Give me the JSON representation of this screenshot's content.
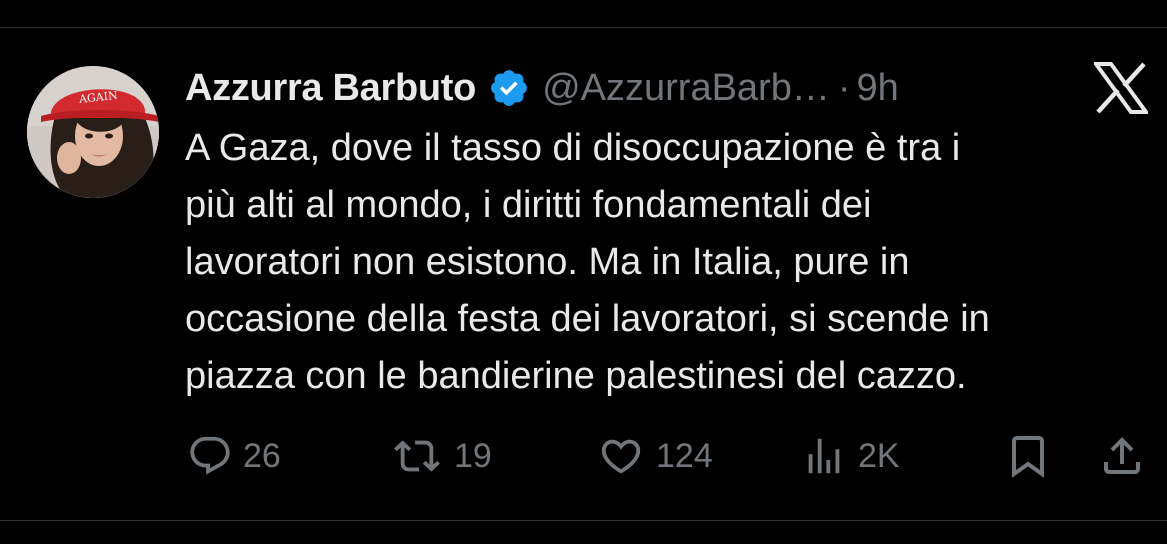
{
  "author": {
    "display_name": "Azzurra Barbuto",
    "handle": "@AzzurraBarb…",
    "separator": "·",
    "time": "9h",
    "verified": true,
    "avatar_cap_text": "AGAIN"
  },
  "tweet": {
    "lines": [
      "A Gaza, dove il tasso di disoccupazione è tra i",
      "più alti al mondo, i diritti fondamentali dei",
      "lavoratori non esistono. Ma in Italia, pure in",
      "occasione della festa dei lavoratori, si scende in",
      "piazza con le bandierine palestinesi del cazzo."
    ]
  },
  "actions": {
    "replies": "26",
    "reposts": "19",
    "likes": "124",
    "views": "2K"
  },
  "icons": {
    "verified": "verified-badge-icon",
    "logo": "x-logo-icon",
    "reply": "reply-icon",
    "repost": "repost-icon",
    "like": "heart-icon",
    "views": "views-icon",
    "bookmark": "bookmark-icon",
    "share": "share-icon"
  },
  "colors": {
    "background": "#000000",
    "text": "#e7e9ea",
    "secondary": "#71767b",
    "verified": "#1d9bf0",
    "divider": "#2f3336"
  }
}
